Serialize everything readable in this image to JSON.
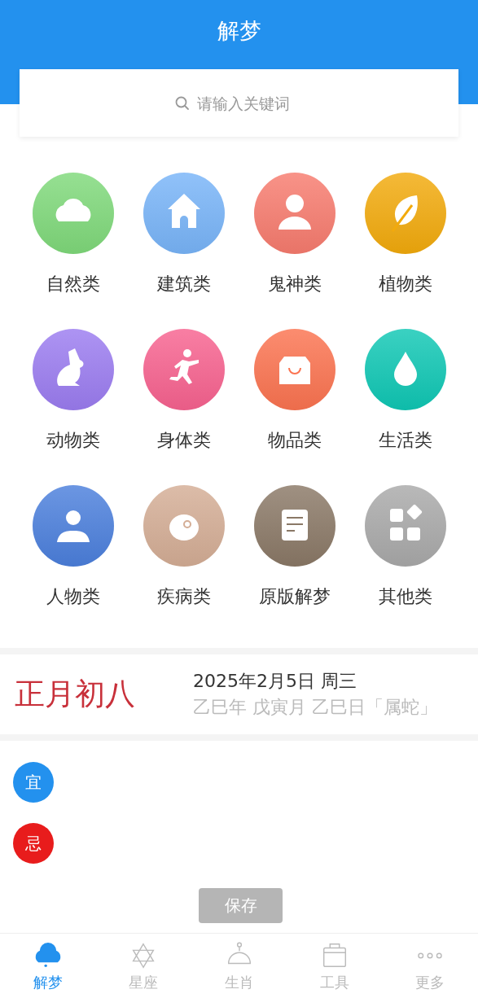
{
  "header": {
    "title": "解梦"
  },
  "search": {
    "placeholder": "请输入关键词"
  },
  "categories": [
    {
      "label": "自然类",
      "color": "#7fd97a"
    },
    {
      "label": "建筑类",
      "color": "#78b4f8"
    },
    {
      "label": "鬼神类",
      "color": "#f77b6e"
    },
    {
      "label": "植物类",
      "color": "#f2aa0c"
    },
    {
      "label": "动物类",
      "color": "#9b7cf0"
    },
    {
      "label": "身体类",
      "color": "#f7628f"
    },
    {
      "label": "物品类",
      "color": "#fb7350"
    },
    {
      "label": "生活类",
      "color": "#0fc7b4"
    },
    {
      "label": "人物类",
      "color": "#4b7fdc"
    },
    {
      "label": "疾病类",
      "color": "#d4ad95"
    },
    {
      "label": "原版解梦",
      "color": "#8a7866"
    },
    {
      "label": "其他类",
      "color": "#a9a9a9"
    }
  ],
  "calendar": {
    "lunar_date": "正月初八",
    "date": "2025年2月5日 周三",
    "ganzhi": "乙巳年 戊寅月 乙巳日「属蛇」"
  },
  "almanac": [
    {
      "label": "宜",
      "color": "#2391ee"
    },
    {
      "label": "忌",
      "color": "#e81c1c"
    }
  ],
  "tabs": [
    {
      "label": "解梦",
      "selected": true
    },
    {
      "label": "星座",
      "selected": false
    },
    {
      "label": "生肖",
      "selected": false
    },
    {
      "label": "工具",
      "selected": false
    },
    {
      "label": "更多",
      "selected": false
    }
  ],
  "toast": {
    "text": "保存"
  }
}
